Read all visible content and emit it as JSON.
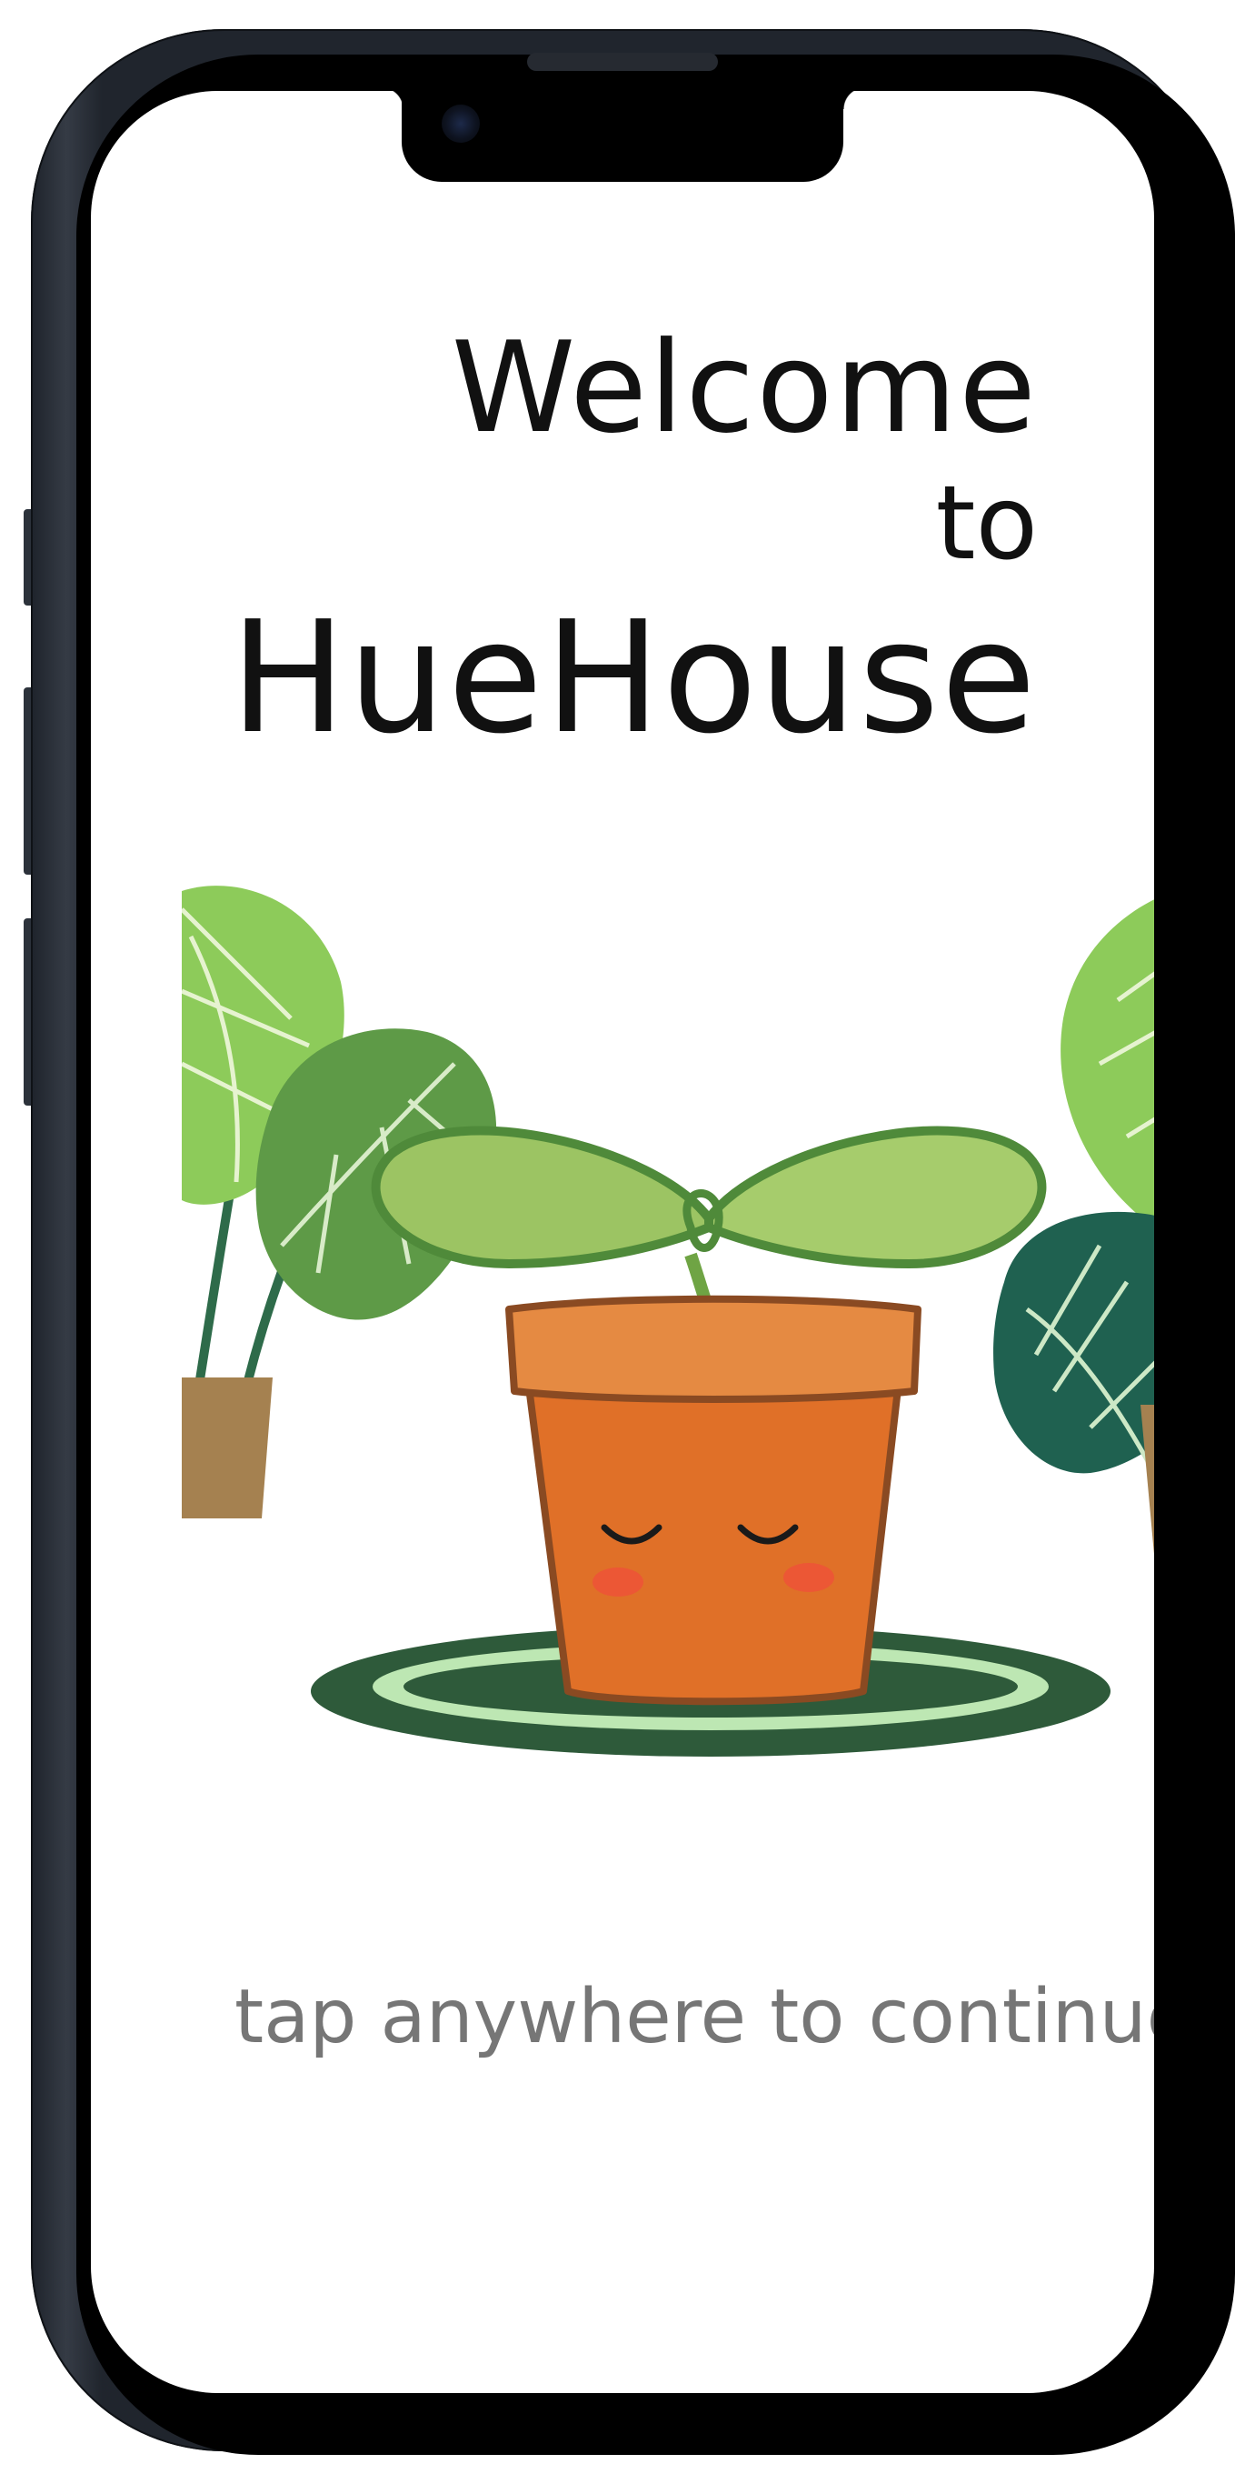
{
  "welcome": {
    "line1": "Welcome",
    "line2": "to",
    "app_name": "HueHouse"
  },
  "hint": {
    "text": "tap anywhere to continue"
  },
  "illustration": {
    "mascot": "potted-sprout-mascot",
    "left_plant": "monstera-plant-left",
    "right_plant": "monstera-plant-right"
  },
  "colors": {
    "pot": "#E07028",
    "pot_rim": "#E58A42",
    "sprout": "#9CC463",
    "rug_dark": "#2E5A3A",
    "rug_light": "#BDE7B3",
    "monstera_light": "#8DCB5A",
    "monstera_mid": "#5E9A47",
    "monstera_dark": "#1F6150",
    "planter": "#A58150",
    "hint_text": "#767676",
    "title_text": "#111111"
  }
}
